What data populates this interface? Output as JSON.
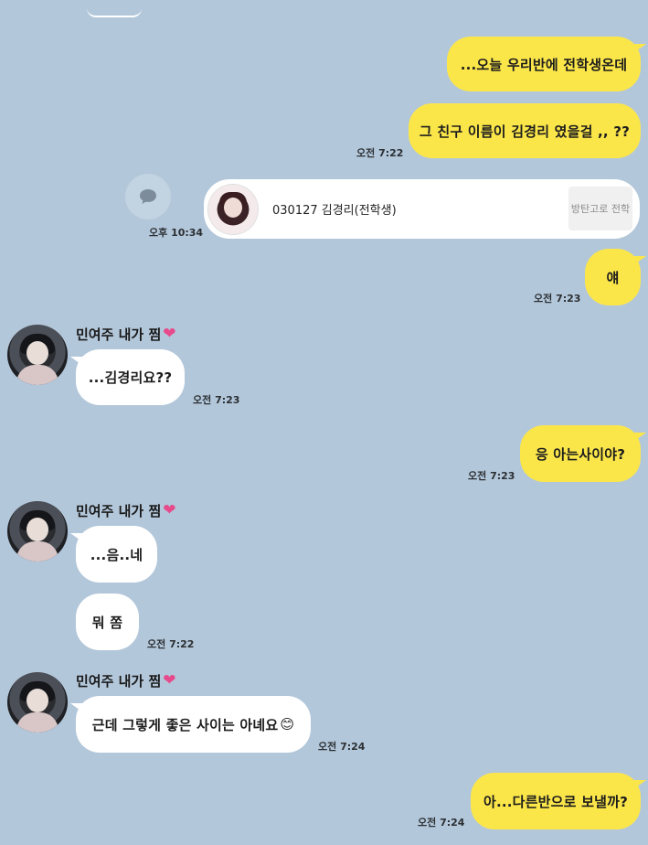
{
  "theme": {
    "background": "#b3c7da",
    "my_bubble": "#fbe64a",
    "their_bubble": "#ffffff",
    "heart": "#e64a8a"
  },
  "messages": {
    "m1": {
      "text": "...오늘 우리반에 전학생온데"
    },
    "m2": {
      "text": "그 친구 이름이 김경리 였을걸 ,, ??",
      "time": "오전 7:22"
    },
    "share": {
      "time": "오후 10:34",
      "card_title": "030127 김경리(전학생)",
      "card_button": "방탄고로 전학",
      "comment_icon": "speech-bubble-icon"
    },
    "m3": {
      "text": "얘",
      "time": "오전 7:23"
    },
    "g1": {
      "sender": "민여주 내가 찜",
      "heart": "❤",
      "text": "...김경리요??",
      "time": "오전 7:23"
    },
    "m4": {
      "text": "응 아는사이야?",
      "time": "오전 7:23"
    },
    "g2": {
      "sender": "민여주 내가 찜",
      "heart": "❤",
      "text1": "...음..네",
      "text2": "뭐 쫌",
      "time": "오전 7:22"
    },
    "g3": {
      "sender": "민여주 내가 찜",
      "heart": "❤",
      "text": "근데 그렇게 좋은 사이는 아녜요",
      "emoji": "😊",
      "time": "오전 7:24"
    },
    "m5": {
      "text": "아...다른반으로 보낼까?",
      "time": "오전 7:24"
    }
  }
}
